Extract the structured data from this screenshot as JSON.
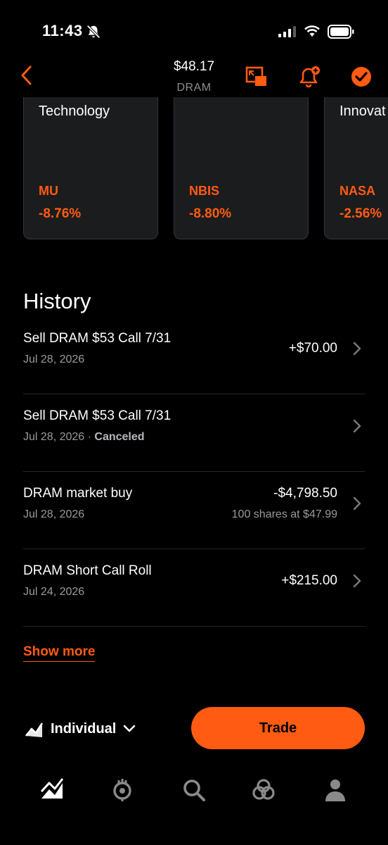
{
  "status_bar": {
    "time": "11:43"
  },
  "header": {
    "price": "$48.17",
    "ticker": "DRAM"
  },
  "colors": {
    "accent": "#ff5b12",
    "background": "#000000",
    "card": "#1b1c1e",
    "muted": "#9a9a9a"
  },
  "cards": [
    {
      "title": "Technology",
      "ticker": "MU",
      "change": "-8.76%"
    },
    {
      "title": "",
      "ticker": "NBIS",
      "change": "-8.80%"
    },
    {
      "title": "Innovat",
      "ticker": "NASA",
      "change": "-2.56%"
    }
  ],
  "history": {
    "title": "History",
    "items": [
      {
        "title": "Sell DRAM $53 Call 7/31",
        "date": "Jul 28, 2026",
        "status": "",
        "amount": "+$70.00",
        "sub": ""
      },
      {
        "title": "Sell DRAM $53 Call 7/31",
        "date": "Jul 28, 2026 · ",
        "status": "Canceled",
        "amount": "",
        "sub": ""
      },
      {
        "title": "DRAM market buy",
        "date": "Jul 28, 2026",
        "status": "",
        "amount": "-$4,798.50",
        "sub": "100 shares at $47.99"
      },
      {
        "title": "DRAM Short Call Roll",
        "date": "Jul 24, 2026",
        "status": "",
        "amount": "+$215.00",
        "sub": ""
      }
    ],
    "show_more": "Show more"
  },
  "account": {
    "label": "Individual",
    "icon": "chart-icon"
  },
  "trade_button": {
    "label": "Trade"
  },
  "tabs": [
    {
      "name": "investing",
      "icon": "chart-icon",
      "active": true
    },
    {
      "name": "crypto",
      "icon": "crypto-icon",
      "active": false
    },
    {
      "name": "search",
      "icon": "search-icon",
      "active": false
    },
    {
      "name": "network",
      "icon": "network-icon",
      "active": false
    },
    {
      "name": "account",
      "icon": "person-icon",
      "active": false
    }
  ]
}
